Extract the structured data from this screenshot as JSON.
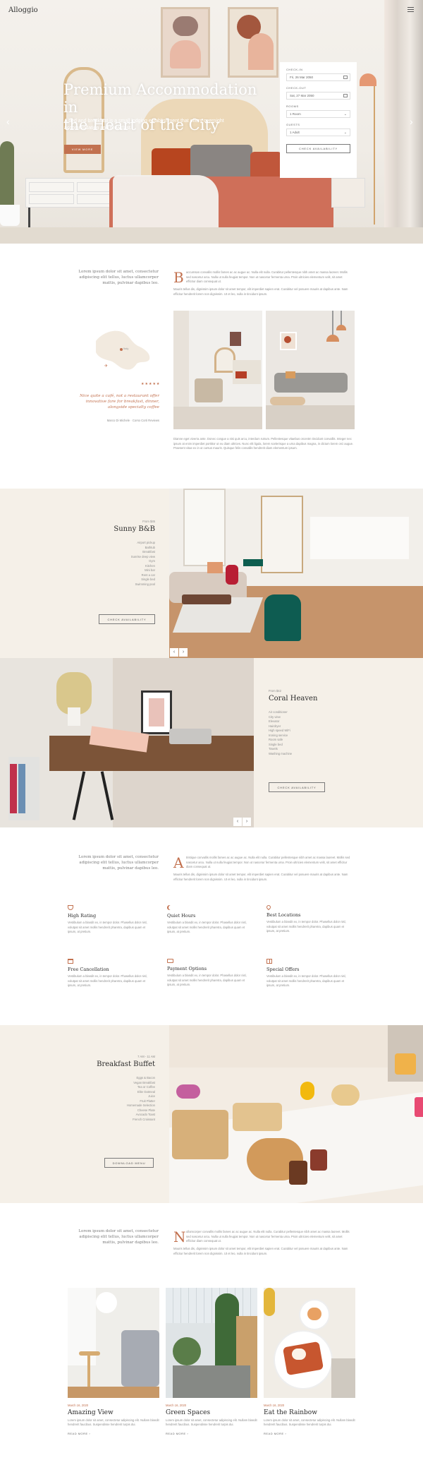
{
  "header": {
    "logo": "Alloggio",
    "menu_icon": "hamburger-icon"
  },
  "hero": {
    "title_line1": "Premium Accommodation in",
    "title_line2": "the Heart of the City",
    "subtitle": "A bed and breakfast is a small lodging establishment that offers overnight accommodation and breakfast.",
    "button": "View More"
  },
  "booking": {
    "checkin_label": "Check-in",
    "checkin_value": "Fri, 26 Mar 2050",
    "checkout_label": "Check-out",
    "checkout_value": "Sat, 27 Mar 2050",
    "rooms_label": "Rooms",
    "rooms_value": "1 Room",
    "guests_label": "Guests",
    "guests_value": "1 Adult",
    "button": "Check Availability"
  },
  "intro1": {
    "lead": "Lorem ipsum dolor sit amet, consectetur adipiscing elit tellus, luctus ullamcorper mattis, pulvinar dapibus leo.",
    "dropcap": "B",
    "para": "accumsan convallis mollis fames ac ac augue ac. Nulla elit nulla. Curabitur pellentesque nibh amet ac massa laoreet. Mollis sed nascetur arcu. Nulla ut nulla feugiat tempor. Non ut nascetur fermenta urna. Proin ultricies elementum velit, sit amet efficitur diam consequat ut.",
    "para2": "Mauris tellus dis, dignissim ipsum dolor sit amet tempor, elit imperdiet sapien erat. Curabitur vel posuere mauris at dapibus ante. Nam efficitur hendrerit lorem non dignissim. Ut et leo, nulla in tincidunt ipsum.",
    "map_label": "Italy",
    "quote": "Nice quite a café, not a restaurant offer innovative fare for breakfast, dinner, alongside specialty coffee",
    "quote_author": "Marco Di Michele",
    "quote_source": "Corso Corti Reviews",
    "stars": "★★★★★",
    "after_para": "Dianne eget viverra ante. Donec congue a nisi quis arcu, interdum rutrum. Pellentesque vitaebus orcentm tincidunt convallis. Integer nec ipsum at enim imperdiet porttitor ut eu diam ultrices. Nunc elit ligula, lorem scelerisque a urna dapibus magna, in dictum lorem orci augue. Praesent vitae ex in ut cursus mauris. Quisque felis convallis hendrerit diam elementum ipsum."
  },
  "room1": {
    "price": "From $45",
    "name": "Sunny B&B",
    "features": [
      "Airport pickup",
      "Bathtub",
      "Breakfast",
      "Sunrise deep view",
      "Gym",
      "Kitchen",
      "Mini bar",
      "Rent a car",
      "Single bed",
      "Swimming pool"
    ],
    "button": "Check Availability",
    "prev": "‹",
    "next": "›"
  },
  "room2": {
    "price": "From $42",
    "name": "Coral Heaven",
    "features": [
      "Air conditioner",
      "City view",
      "Elevator",
      "Hairdryer",
      "High speed WiFi",
      "Ironing service",
      "Room safe",
      "Single bed",
      "Towels",
      "Washing machine"
    ],
    "button": "Check Availability",
    "prev": "‹",
    "next": "›"
  },
  "intro2": {
    "lead": "Lorem ipsum dolor sit amet, consectetur adipiscing elit tellus, luctus ullamcorper mattis, pulvinar dapibus leo.",
    "dropcap": "A",
    "para": "tristique convallis mollis fames ac ac augue ac. Nulla elit nulla. Curabitur pellentesque nibh amet ac massa laoreet. Mollis sed nascetur arcu. Nulla ut nulla feugiat tempor. Non ut nascetur fermenta urna. Proin ultricies elementum velit, sit amet efficitur diam consequat ut.",
    "para2": "Mauris tellus dis, dignissim ipsum dolor sit amet tempor, elit imperdiet sapien erat. Curabitur vel posuere mauris at dapibus ante. Nam efficitur hendrerit lorem non dignissim. Ut et leo, nulla in tincidunt ipsum."
  },
  "features": [
    {
      "icon": "trophy-icon",
      "title": "High Rating",
      "text": "Vestibulum a blandit ex, in tempor dolor. Phasellus dolor nisl, volutpat sit amet mollis hendrerit pharetra, dapibus quam et ipsum, at pretium."
    },
    {
      "icon": "moon-icon",
      "title": "Quiet Hours",
      "text": "Vestibulum a blandit ex, in tempor dolor. Phasellus dolor nisl, volutpat sit amet mollis hendrerit pharetra, dapibus quam et ipsum, at pretium."
    },
    {
      "icon": "map-pin-icon",
      "title": "Best Locations",
      "text": "Vestibulum a blandit ex, in tempor dolor. Phasellus dolor nisl, volutpat sit amet mollis hendrerit pharetra, dapibus quam et ipsum, at pretium."
    },
    {
      "icon": "calendar-icon",
      "title": "Free Cancellation",
      "text": "Vestibulum a blandit ex, in tempor dolor. Phasellus dolor nisl, volutpat sit amet mollis hendrerit pharetra, dapibus quam et ipsum, at pretium."
    },
    {
      "icon": "wallet-icon",
      "title": "Payment Options",
      "text": "Vestibulum a blandit ex, in tempor dolor. Phasellus dolor nisl, volutpat sit amet mollis hendrerit pharetra, dapibus quam et ipsum, at pretium."
    },
    {
      "icon": "gift-icon",
      "title": "Special Offers",
      "text": "Vestibulum a blandit ex, in tempor dolor. Phasellus dolor nisl, volutpat sit amet mollis hendrerit pharetra, dapibus quam et ipsum, at pretium."
    }
  ],
  "breakfast": {
    "hours": "7 AM - 11 AM",
    "title": "Breakfast Buffet",
    "items": [
      "Eggs & Bacon",
      "Vegan Breakfast",
      "Tea or Coffee",
      "Elite Oatmeal",
      "Juice",
      "Fruit Platter",
      "Homemade Selection",
      "Cheese Plate",
      "Avocado Toast",
      "French Croissant"
    ],
    "button": "Download Menu"
  },
  "intro3": {
    "lead": "Lorem ipsum dolor sit amet, consectetur adipiscing elit tellus, luctus ullamcorper mattis, pulvinar dapibus leo.",
    "dropcap": "N",
    "para": "ullamcorper convallis mollis fames ac ac augue ac. Nulla elit nulla. Curabitur pellentesque nibh amet ac massa laoreet. Mollis sed nascetur arcu. Nulla ut nulla feugiat tempor. Non ut nascetur fermenta urna. Proin ultricies elementum velit, sit amet efficitur diam consequat ut.",
    "para2": "Mauris tellus dis, dignissim ipsum dolor sit amet tempor, elit imperdiet sapien erat. Curabitur vel posuere mauris at dapibus ante. Nam efficitur hendrerit lorem non dignissim. Ut et leo, nulla in tincidunt ipsum."
  },
  "posts": [
    {
      "date": "March 16, 2020",
      "title": "Amazing View",
      "excerpt": "Lorem ipsum dolor sit amet, consectetur adipiscing elit. Nullam blandit hendrerit faucibus. Suspendisse hendrerit turpis dui.",
      "more": "Read More"
    },
    {
      "date": "March 16, 2020",
      "title": "Green Spaces",
      "excerpt": "Lorem ipsum dolor sit amet, consectetur adipiscing elit. Nullam blandit hendrerit faucibus. Suspendisse hendrerit turpis dui.",
      "more": "Read More"
    },
    {
      "date": "March 16, 2020",
      "title": "Eat the Rainbow",
      "excerpt": "Lorem ipsum dolor sit amet, consectetur adipiscing elit. Nullam blandit hendrerit faucibus. Suspendisse hendrerit turpis dui.",
      "more": "Read More"
    }
  ],
  "colors": {
    "accent": "#c2714f",
    "beige": "#f5f0e8",
    "dark": "#2b2b2b"
  }
}
